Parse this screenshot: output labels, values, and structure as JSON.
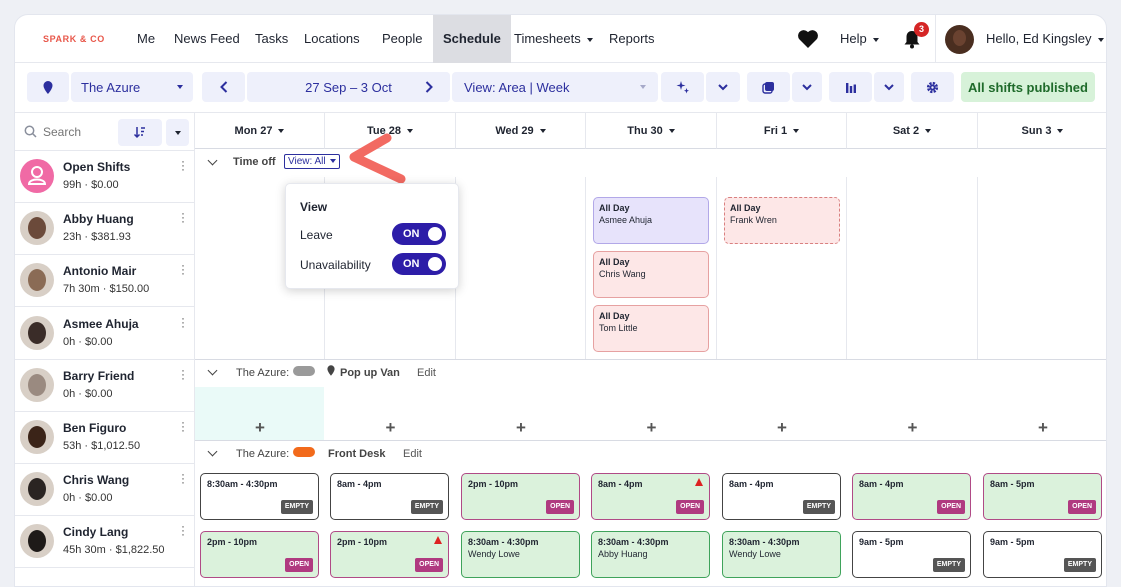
{
  "nav": {
    "logo": "SPARK & CO",
    "items": [
      "Me",
      "News Feed",
      "Tasks",
      "Locations",
      "People",
      "Schedule",
      "Timesheets",
      "Reports"
    ],
    "active": "Schedule",
    "help": "Help",
    "notifications": "3",
    "greeting": "Hello, Ed Kingsley"
  },
  "toolbar": {
    "location": "The Azure",
    "date_range": "27 Sep – 3 Oct",
    "view": "View: Area |  Week",
    "published": "All shifts published"
  },
  "sidebar": {
    "search_placeholder": "Search",
    "people": [
      {
        "name": "Open Shifts",
        "meta": "99h · $0.00",
        "avatar": "open-shifts"
      },
      {
        "name": "Abby Huang",
        "meta": "23h · $381.93",
        "avatar": "#6b4a3a"
      },
      {
        "name": "Antonio Mair",
        "meta": "7h 30m · $150.00",
        "avatar": "#8a6b55"
      },
      {
        "name": "Asmee Ahuja",
        "meta": "0h · $0.00",
        "avatar": "#3a2c28"
      },
      {
        "name": "Barry Friend",
        "meta": "0h · $0.00",
        "avatar": "#9a8a80"
      },
      {
        "name": "Ben Figuro",
        "meta": "53h · $1,012.50",
        "avatar": "#3b2418"
      },
      {
        "name": "Chris Wang",
        "meta": "0h · $0.00",
        "avatar": "#2a2422"
      },
      {
        "name": "Cindy Lang",
        "meta": "45h 30m · $1,822.50",
        "avatar": "#1e1a18"
      }
    ]
  },
  "days": [
    "Mon 27",
    "Tue 28",
    "Wed 29",
    "Thu 30",
    "Fri 1",
    "Sat 2",
    "Sun 3"
  ],
  "time_off": {
    "label": "Time off",
    "view_link": "View: All",
    "entries": [
      {
        "day": 3,
        "row": 0,
        "title": "All Day",
        "who": "Asmee Ahuja",
        "style": "purple"
      },
      {
        "day": 3,
        "row": 1,
        "title": "All Day",
        "who": "Chris Wang",
        "style": "red"
      },
      {
        "day": 3,
        "row": 2,
        "title": "All Day",
        "who": "Tom Little",
        "style": "red"
      },
      {
        "day": 4,
        "row": 0,
        "title": "All Day",
        "who": "Frank Wren",
        "style": "dashed"
      }
    ]
  },
  "popup": {
    "title": "View",
    "rows": [
      {
        "label": "Leave",
        "state": "ON"
      },
      {
        "label": "Unavailability",
        "state": "ON"
      }
    ]
  },
  "areas": [
    {
      "prefix": "The Azure:",
      "name": "Pop up Van",
      "edit": "Edit",
      "color": "#9a9a9a"
    },
    {
      "prefix": "The Azure:",
      "name": "Front Desk",
      "edit": "Edit",
      "color": "#f26a1b"
    }
  ],
  "shifts": [
    {
      "day": 0,
      "row": 0,
      "time": "8:30am - 4:30pm",
      "who": "",
      "style": "white",
      "badge": "EMPTY",
      "warn": false
    },
    {
      "day": 1,
      "row": 0,
      "time": "8am - 4pm",
      "who": "",
      "style": "white",
      "badge": "EMPTY",
      "warn": false
    },
    {
      "day": 2,
      "row": 0,
      "time": "2pm - 10pm",
      "who": "",
      "style": "green",
      "badge": "OPEN",
      "warn": false
    },
    {
      "day": 3,
      "row": 0,
      "time": "8am - 4pm",
      "who": "",
      "style": "green",
      "badge": "OPEN",
      "warn": true
    },
    {
      "day": 4,
      "row": 0,
      "time": "8am - 4pm",
      "who": "",
      "style": "white",
      "badge": "EMPTY",
      "warn": false
    },
    {
      "day": 5,
      "row": 0,
      "time": "8am - 4pm",
      "who": "",
      "style": "green",
      "badge": "OPEN",
      "warn": false
    },
    {
      "day": 6,
      "row": 0,
      "time": "8am - 5pm",
      "who": "",
      "style": "green",
      "badge": "OPEN",
      "warn": false
    },
    {
      "day": 0,
      "row": 1,
      "time": "2pm - 10pm",
      "who": "",
      "style": "green",
      "badge": "OPEN",
      "warn": false
    },
    {
      "day": 1,
      "row": 1,
      "time": "2pm - 10pm",
      "who": "",
      "style": "green",
      "badge": "OPEN",
      "warn": true
    },
    {
      "day": 2,
      "row": 1,
      "time": "8:30am - 4:30pm",
      "who": "Wendy Lowe",
      "style": "greenw",
      "badge": "",
      "warn": false
    },
    {
      "day": 3,
      "row": 1,
      "time": "8:30am - 4:30pm",
      "who": "Abby Huang",
      "style": "greenw",
      "badge": "",
      "warn": false
    },
    {
      "day": 4,
      "row": 1,
      "time": "8:30am - 4:30pm",
      "who": "Wendy Lowe",
      "style": "greenw",
      "badge": "",
      "warn": false
    },
    {
      "day": 5,
      "row": 1,
      "time": "9am - 5pm",
      "who": "",
      "style": "white",
      "badge": "EMPTY",
      "warn": false
    },
    {
      "day": 6,
      "row": 1,
      "time": "9am - 5pm",
      "who": "",
      "style": "white",
      "badge": "EMPTY",
      "warn": false
    }
  ],
  "colors": {
    "accent": "#2c2f9e",
    "brand": "#e8574a",
    "toggle": "#2d1da8",
    "published_bg": "#d7f2d9"
  }
}
